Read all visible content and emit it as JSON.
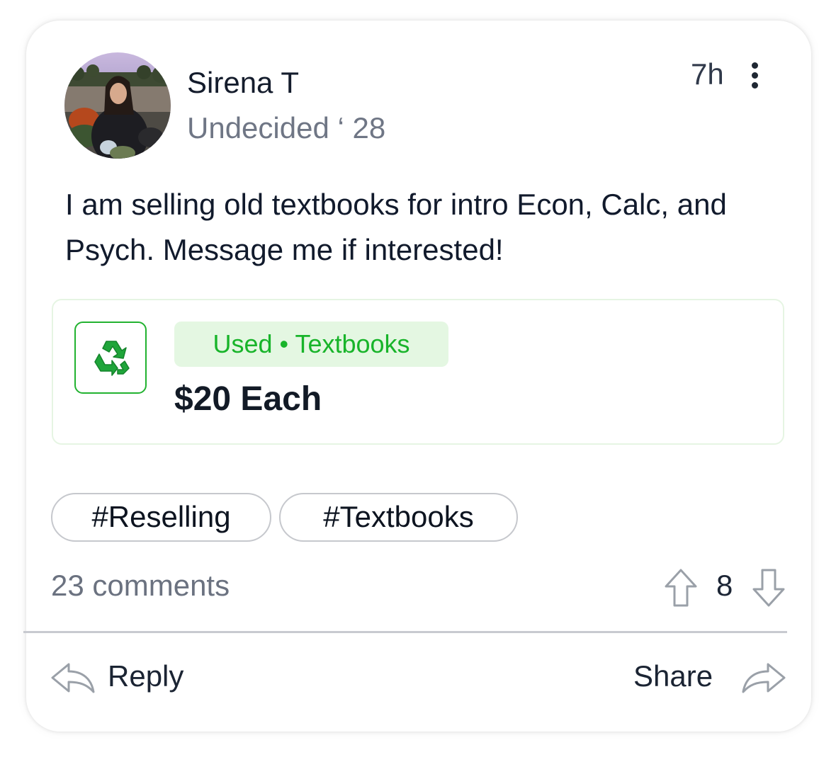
{
  "post": {
    "author": "Sirena T",
    "subtitle": "Undecided ‘ 28",
    "time": "7h",
    "body": "I am selling old textbooks for intro Econ, Calc, and Psych. Message me if interested!"
  },
  "listing": {
    "icon": "recycle-icon",
    "category": "Used • Textbooks",
    "price": "$20 Each",
    "accent_color": "#18b42a"
  },
  "tags": [
    "#Reselling",
    "#Textbooks"
  ],
  "stats": {
    "comments": "23 comments",
    "votes": "8"
  },
  "actions": {
    "reply": "Reply",
    "share": "Share"
  }
}
